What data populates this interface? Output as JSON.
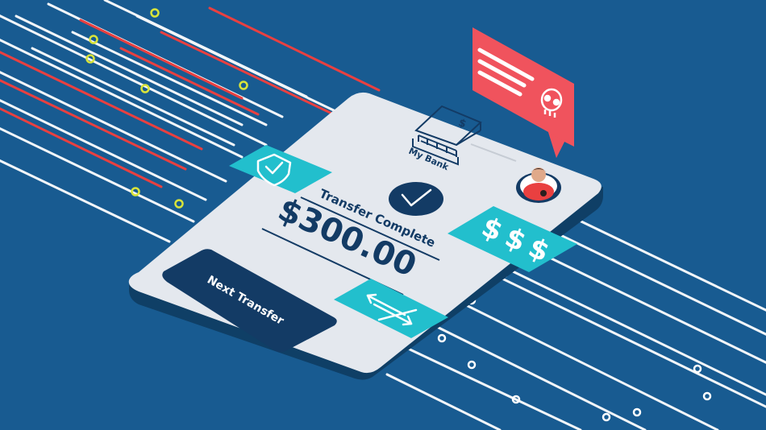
{
  "bank": {
    "name": "My Bank",
    "symbol": "$"
  },
  "transfer": {
    "status": "Transfer Complete",
    "amount": "$300.00",
    "next_button_label": "Next Transfer"
  },
  "tags": {
    "money_symbols": "$$$"
  },
  "icons": {
    "shield": "shield-check-icon",
    "check": "check-icon",
    "transfer": "swap-arrows-icon",
    "skull": "skull-icon",
    "bank": "bank-icon"
  },
  "colors": {
    "background": "#185b91",
    "phone_screen": "#e4e8ee",
    "phone_side": "#0f3f66",
    "navy": "#133b65",
    "teal": "#22bfcd",
    "alert_red": "#f0535d",
    "accent_yellow": "#d9e43a"
  }
}
